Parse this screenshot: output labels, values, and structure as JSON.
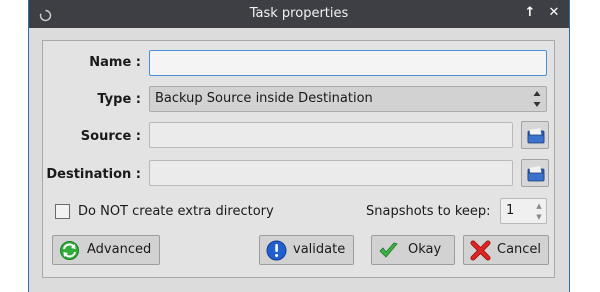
{
  "window": {
    "title": "Task properties",
    "maximize_glyph": "↑",
    "close_glyph": "✕"
  },
  "form": {
    "name_label": "Name :",
    "name_value": "",
    "type_label": "Type :",
    "type_value": "Backup Source inside Destination",
    "source_label": "Source :",
    "source_value": "",
    "destination_label": "Destination :",
    "destination_value": "",
    "extra_dir_label": "Do NOT create extra directory",
    "extra_dir_checked": false,
    "snapshots_label": "Snapshots to keep:",
    "snapshots_value": "1"
  },
  "buttons": {
    "advanced": "Advanced",
    "validate": "validate",
    "okay": "Okay",
    "cancel": "Cancel"
  },
  "icons": {
    "title": "refresh-icon",
    "browse": "folder-browse-icon",
    "advanced": "green-arrows-icon",
    "validate": "info-icon",
    "okay": "green-check-icon",
    "cancel": "red-x-icon"
  },
  "colors": {
    "titlebar": "#3d3f45",
    "accent": "#4a90d9",
    "window_bg": "#dcdcdc"
  }
}
